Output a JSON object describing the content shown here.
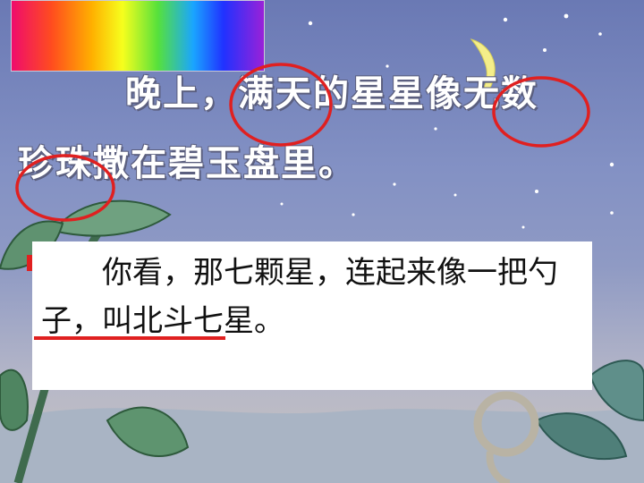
{
  "slide": {
    "line1": "晚上，满天的星星像无数",
    "line2": "珍珠撒在碧玉盘里。",
    "callout_text": "你看，那七颗星，连起来像一把勺子，叫北斗七星。"
  },
  "colors": {
    "annotation_red": "#e02020",
    "poem_text": "#ffffff",
    "callout_background": "#ffffff",
    "moon": "#f4ee8a"
  },
  "icons": [
    "moon-icon",
    "star-icon",
    "rainbow-banner"
  ]
}
